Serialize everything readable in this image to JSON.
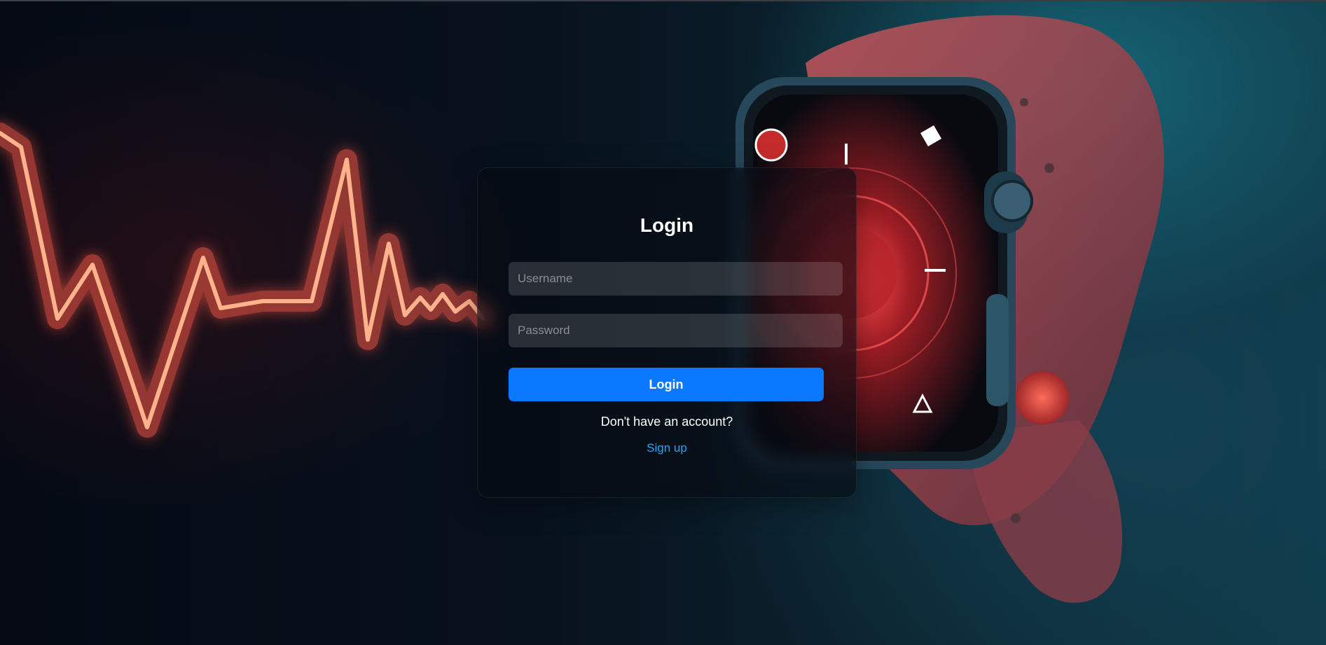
{
  "login": {
    "title": "Login",
    "username_placeholder": "Username",
    "password_placeholder": "Password",
    "submit_label": "Login",
    "no_account_text": "Don't have an account?",
    "signup_link": "Sign up"
  },
  "colors": {
    "button": "#0a78ff",
    "link": "#1ea7ff",
    "pulse": "#ff5a4a"
  }
}
